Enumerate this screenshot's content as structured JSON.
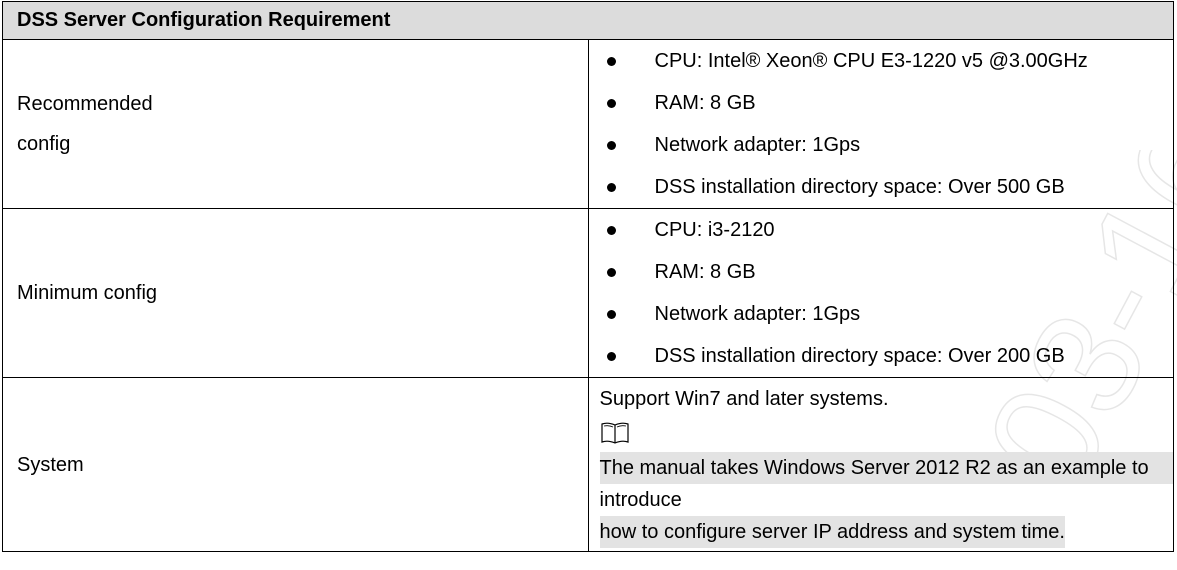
{
  "table": {
    "title": "DSS Server Configuration Requirement",
    "rows": [
      {
        "label_lines": [
          "Recommended",
          "config"
        ],
        "items": [
          "CPU: Intel® Xeon® CPU E3-1220 v5 @3.00GHz",
          "RAM: 8 GB",
          "Network adapter: 1Gps",
          "DSS installation directory space: Over 500 GB"
        ]
      },
      {
        "label_lines": [
          "Minimum config"
        ],
        "items": [
          "CPU: i3-2120",
          "RAM: 8 GB",
          "Network adapter: 1Gps",
          "DSS installation directory space: Over 200 GB"
        ]
      }
    ],
    "system": {
      "label": "System",
      "text": "Support Win7 and later systems.",
      "note_icon": "book-icon",
      "note_lines": [
        "The manual takes Windows Server 2012 R2 as an example to introduce",
        "how to configure server IP address and system time."
      ]
    }
  },
  "watermark": {
    "text": "03-16",
    "color": "#e6e6e6"
  },
  "colors": {
    "header_bg": "#dcdcdc",
    "note_bg": "#e3e3e3"
  }
}
